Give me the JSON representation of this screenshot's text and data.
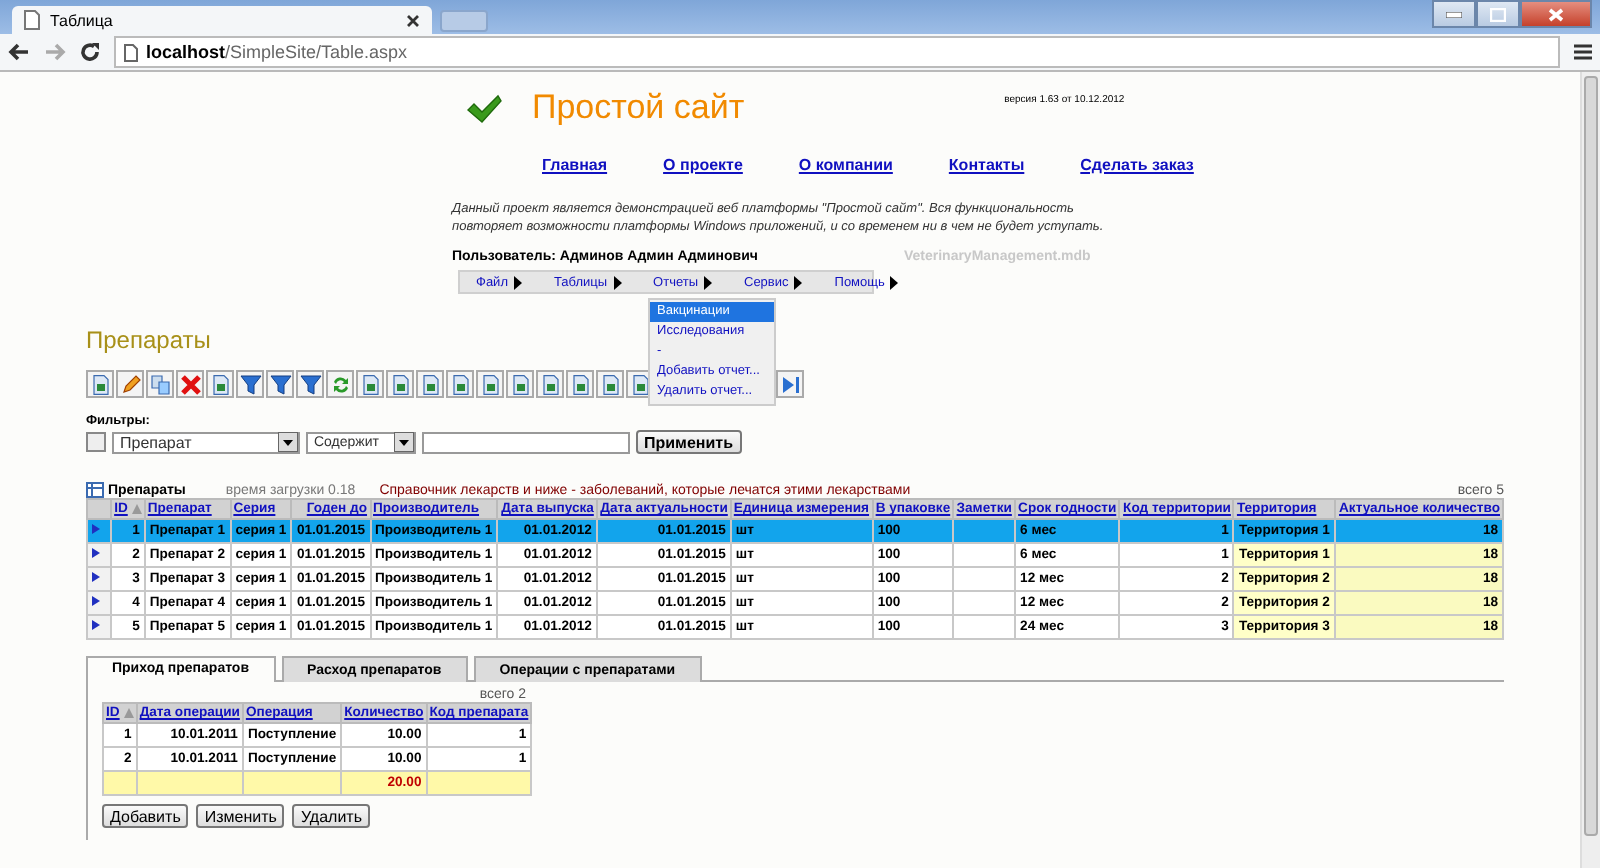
{
  "browser": {
    "tab_title": "Таблица",
    "address": "**localhost**/SimpleSite/Table.aspx"
  },
  "header": {
    "title": "Простой сайт",
    "version": "версия 1.63 от 10.12.2012"
  },
  "nav_links": [
    "Главная",
    "О проекте",
    "О компании",
    "Контакты",
    "Сделать заказ"
  ],
  "description": "Данный проект является демонстрацией веб платформы \"Простой сайт\". Вся функциональность повторяет возможности платформы Windows приложений, и со временем ни в чем не будет уступать.",
  "user": "Пользователь: Админов Админ Админович",
  "database": "VeterinaryManagement.mdb",
  "menu": [
    {
      "label": "Файл"
    },
    {
      "label": "Таблицы"
    },
    {
      "label": "Отчеты",
      "items": [
        {
          "label": "Вакцинации",
          "selected": true
        },
        {
          "label": "Исследования",
          "selected": false
        },
        {
          "label": "-",
          "selected": false
        },
        {
          "label": "Добавить отчет...",
          "selected": false
        },
        {
          "label": "Удалить отчет...",
          "selected": false
        }
      ]
    },
    {
      "label": "Сервис"
    },
    {
      "label": "Помощь"
    }
  ],
  "page_title": "Препараты",
  "filters": {
    "label": "Фильтры:",
    "checked": false,
    "field": "Препарат",
    "operator": "Содержит",
    "apply": "Применить"
  },
  "table": {
    "title": "Препараты",
    "load_time": "время загрузки 0.18",
    "description": "Справочник лекарств и ниже - заболеваний, которые лечатся этими лекарствами",
    "total": "всего 5",
    "columns": [
      "ID",
      "Препарат",
      "Серия",
      "Годен до",
      "Производитель",
      "Дата выпуска",
      "Дата актуальности",
      "Единица измерения",
      "В упаковке",
      "Заметки",
      "Срок годности",
      "Код территории",
      "Территория",
      "Актуальное количество"
    ],
    "rows": [
      {
        "selected": true,
        "cells": [
          "1",
          "Препарат 1",
          "серия 1",
          "01.01.2015",
          "Производитель 1",
          "01.01.2012",
          "01.01.2015",
          "шт",
          "100",
          "",
          "6 мес",
          "1",
          "Территория 1",
          "18"
        ]
      },
      {
        "selected": false,
        "cells": [
          "2",
          "Препарат 2",
          "серия 1",
          "01.01.2015",
          "Производитель 1",
          "01.01.2012",
          "01.01.2015",
          "шт",
          "100",
          "",
          "6 мес",
          "1",
          "Территория 1",
          "18"
        ]
      },
      {
        "selected": false,
        "cells": [
          "3",
          "Препарат 3",
          "серия 1",
          "01.01.2015",
          "Производитель 1",
          "01.01.2012",
          "01.01.2015",
          "шт",
          "100",
          "",
          "12 мес",
          "2",
          "Территория 2",
          "18"
        ]
      },
      {
        "selected": false,
        "cells": [
          "4",
          "Препарат 4",
          "серия 1",
          "01.01.2015",
          "Производитель 1",
          "01.01.2012",
          "01.01.2015",
          "шт",
          "100",
          "",
          "12 мес",
          "2",
          "Территория 2",
          "18"
        ]
      },
      {
        "selected": false,
        "cells": [
          "5",
          "Препарат 5",
          "серия 1",
          "01.01.2015",
          "Производитель 1",
          "01.01.2012",
          "01.01.2015",
          "шт",
          "100",
          "",
          "24 мес",
          "3",
          "Территория 3",
          "18"
        ]
      }
    ]
  },
  "tabs": [
    {
      "label": "Приход препаратов",
      "selected": true
    },
    {
      "label": "Расход препаратов",
      "selected": false
    },
    {
      "label": "Операции с препаратами",
      "selected": false
    }
  ],
  "subtable": {
    "total": "всего 2",
    "columns": [
      "ID",
      "Дата операции",
      "Операция",
      "Количество",
      "Код препарата"
    ],
    "rows": [
      [
        "1",
        "10.01.2011",
        "Поступление",
        "10.00",
        "1"
      ],
      [
        "2",
        "10.01.2011",
        "Поступление",
        "10.00",
        "1"
      ]
    ],
    "sum": "20.00"
  },
  "buttons": [
    "Добавить",
    "Изменить",
    "Удалить"
  ]
}
